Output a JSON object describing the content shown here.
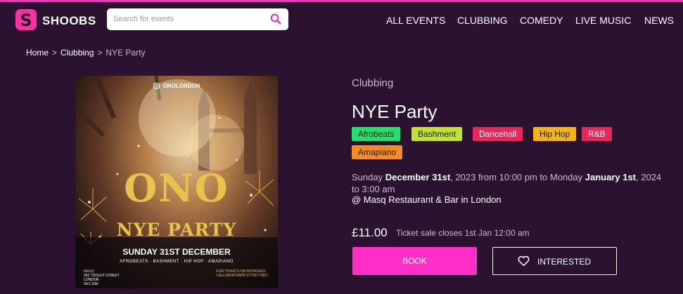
{
  "brand": {
    "name": "SHOOBS",
    "logo_letter": "S"
  },
  "search": {
    "placeholder": "Search for events"
  },
  "nav": [
    "ALL EVENTS",
    "CLUBBING",
    "COMEDY",
    "LIVE MUSIC",
    "NEWS"
  ],
  "breadcrumb": {
    "home": "Home",
    "category": "Clubbing",
    "current": "NYE Party",
    "separator": ">"
  },
  "poster": {
    "handle": "ONOLONDON",
    "logo": "ONO",
    "headline": "NYE PARTY",
    "date": "SUNDAY 31ST DECEMBER",
    "genres": "AFROBEATS · BASHMENT · HIP HOP · AMAPIANO",
    "venue_name": "MASQ",
    "venue_lines": [
      "201 TOOLEY STREET",
      "LONDON",
      "SE1 2UE"
    ],
    "ticket_lines": [
      "FOR TICKETS OR BOOKINGS",
      "CALL/WHATSAPP 07729777807"
    ]
  },
  "event": {
    "category": "Clubbing",
    "title": "NYE Party",
    "tags": [
      {
        "label": "Afrobeats",
        "bg": "#22e06b",
        "fg": "#1a1a1a"
      },
      {
        "label": "Bashment",
        "bg": "#c6e033",
        "fg": "#1a1a1a"
      },
      {
        "label": "Dancehall",
        "bg": "#e8275a",
        "fg": "#ffffff"
      },
      {
        "label": "Hip Hop",
        "bg": "#f4b21b",
        "fg": "#1a1a1a"
      },
      {
        "label": "R&B",
        "bg": "#e8275a",
        "fg": "#ffffff"
      },
      {
        "label": "Amapiano",
        "bg": "#f48c25",
        "fg": "#1a1a1a"
      }
    ],
    "date_parts": {
      "start_day": "Sunday",
      "start_date": "December 31st",
      "start_time": ", 2023 from 10:00 pm to",
      "end_day": "Monday",
      "end_date": "January 1st",
      "end_time": ", 2024 to 3:00 am"
    },
    "venue": "@ Masq Restaurant & Bar in London",
    "price": "£11.00",
    "sale_note": "Ticket sale closes 1st Jan 12:00 am",
    "book_label": "BOOK",
    "interested_label": "INTERESTED"
  },
  "colors": {
    "background": "#2a1230",
    "accent": "#ff2fc8",
    "brand": "#ff2fa4"
  }
}
